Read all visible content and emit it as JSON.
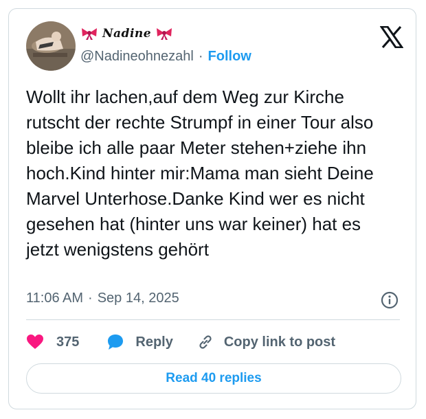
{
  "author": {
    "display_name": "Nadine",
    "handle": "@Nadineohnezahl",
    "separator": "·",
    "follow_label": "Follow"
  },
  "tweet": {
    "text": "Wollt ihr lachen,auf dem Weg zur Kirche rutscht der rechte Strumpf in einer Tour also bleibe ich alle paar Meter stehen+ziehe ihn hoch.Kind hinter mir:Mama man sieht Deine Marvel Unterhose.Danke Kind wer es nicht gesehen hat (hinter uns war keiner) hat es jetzt wenigstens gehört",
    "time": "11:06 AM",
    "separator": "·",
    "date": "Sep 14, 2025"
  },
  "actions": {
    "like_count": "375",
    "reply_label": "Reply",
    "copy_label": "Copy link to post"
  },
  "footer": {
    "read_replies_label": "Read 40 replies"
  },
  "icons": {
    "logo": "x-logo-icon",
    "name_decoration": "ribbon-bow-icon",
    "info": "info-icon",
    "like": "heart-icon",
    "reply": "speech-bubble-icon",
    "copy": "link-icon"
  },
  "colors": {
    "accent": "#1d9bf0",
    "like": "#f91880",
    "secondary_text": "#536471",
    "bow": "#e0245e",
    "border": "#cfd9de"
  }
}
